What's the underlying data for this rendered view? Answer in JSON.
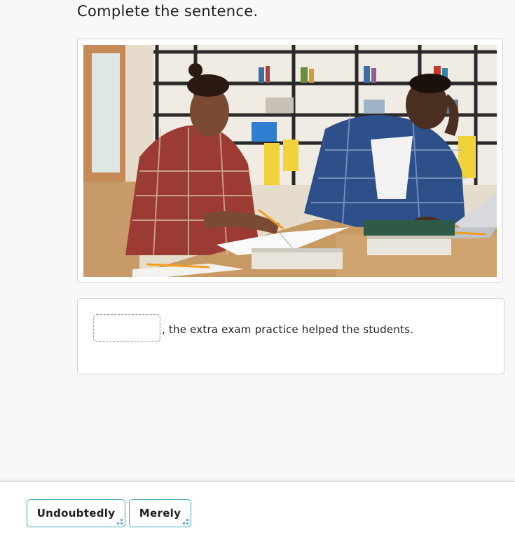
{
  "instruction": "Complete the sentence.",
  "sentence": {
    "blank_value": "",
    "text": ", the extra exam practice helped the students."
  },
  "choices": [
    {
      "label": "Undoubtedly"
    },
    {
      "label": "Merely"
    }
  ],
  "colors": {
    "accent": "#3fa3c4",
    "background": "#f8f8f8"
  }
}
